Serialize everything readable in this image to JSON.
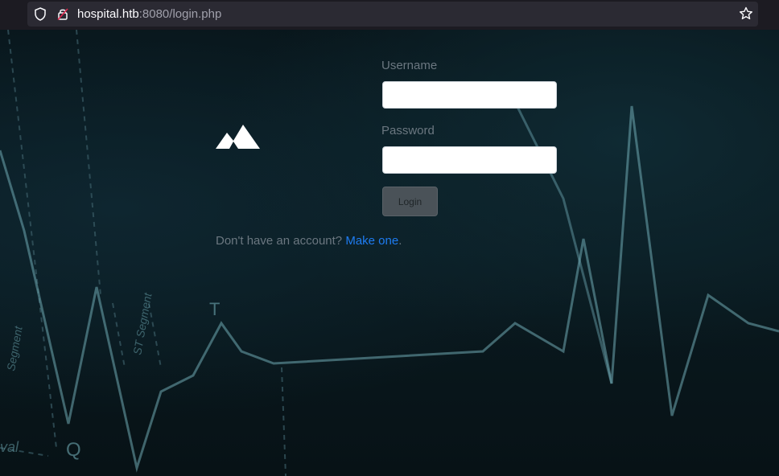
{
  "browser": {
    "url_host": "hospital.htb",
    "url_rest": ":8080/login.php"
  },
  "form": {
    "username_label": "Username",
    "username_value": "",
    "password_label": "Password",
    "password_value": "",
    "login_label": "Login"
  },
  "signup": {
    "prompt": "Don't have an account?",
    "link": "Make one",
    "suffix": "."
  },
  "background_labels": {
    "t_wave": "T",
    "q_wave": "Q",
    "st_segment": "ST Segment",
    "segment": "Segment",
    "interval": "val"
  },
  "colors": {
    "link": "#1e7cf2",
    "ecg_line": "#6fa9b3"
  }
}
